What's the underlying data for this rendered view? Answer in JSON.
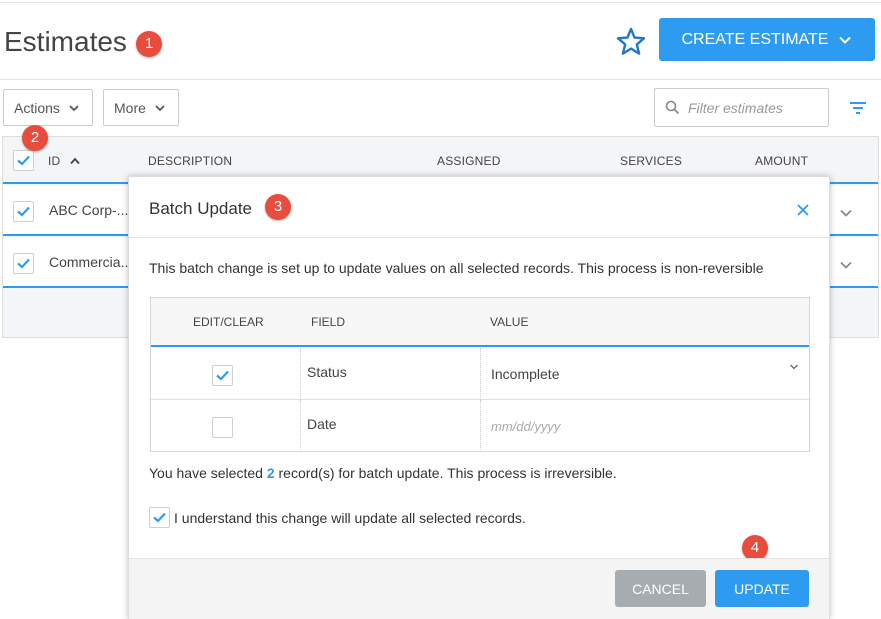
{
  "header": {
    "title": "Estimates",
    "create_button_label": "CREATE ESTIMATE"
  },
  "annotations": [
    "1",
    "2",
    "3",
    "4"
  ],
  "toolbar": {
    "actions_label": "Actions",
    "more_label": "More",
    "filter_placeholder": "Filter estimates"
  },
  "table": {
    "columns": [
      "ID",
      "DESCRIPTION",
      "ASSIGNED",
      "SERVICES",
      "AMOUNT"
    ],
    "rows": [
      {
        "id": "ABC Corp-...",
        "checked": true
      },
      {
        "id": "Commercia...",
        "checked": true
      }
    ]
  },
  "modal": {
    "title": "Batch Update",
    "message": "This batch change is set up to update values on all selected records. This process is non-reversible",
    "columns": [
      "EDIT/CLEAR",
      "FIELD",
      "VALUE"
    ],
    "rows": [
      {
        "field": "Status",
        "value": "Incomplete",
        "checked": true
      },
      {
        "field": "Date",
        "value_placeholder": "mm/dd/yyyy",
        "checked": false
      }
    ],
    "selected_prefix": "You have selected",
    "selected_count": "2",
    "selected_suffix": "record(s) for batch update. This process is irreversible.",
    "understand_label": "I understand this change will update all selected records.",
    "cancel_label": "CANCEL",
    "update_label": "UPDATE"
  },
  "colors": {
    "accent": "#2d9cf0",
    "badge": "#e74c3c",
    "cancel": "#a7acb1"
  }
}
